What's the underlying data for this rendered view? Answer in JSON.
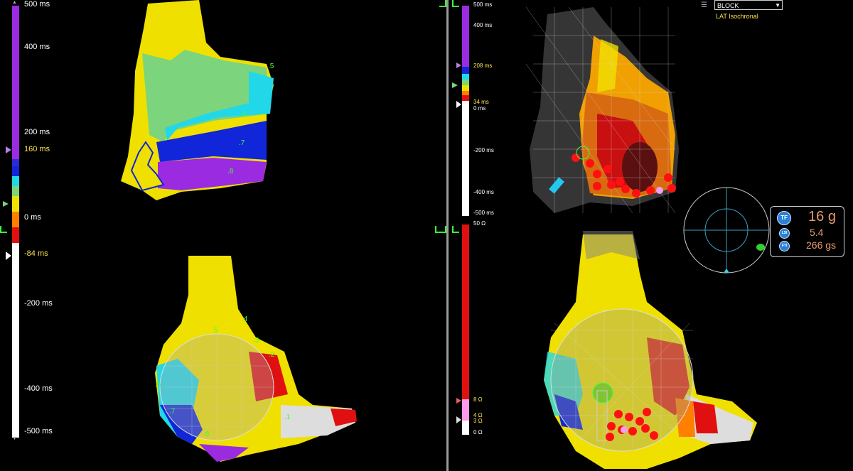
{
  "lat_scale": {
    "max": "500 ms",
    "t400": "400 ms",
    "t200": "200 ms",
    "upper_marker": "160 ms",
    "zero": "0 ms",
    "lower_marker": "-84 ms",
    "n200": "-200 ms",
    "n400": "-400 ms",
    "min": "-500 ms"
  },
  "right_lat_scale": {
    "max": "500 ms",
    "t400": "400 ms",
    "upper_marker": "208 ms",
    "lower_marker": "34 ms",
    "zero": "0 ms",
    "n200": "-200 ms",
    "n400": "-400 ms",
    "min": "-500 ms"
  },
  "impedance_scale": {
    "max": "50 Ω",
    "marker": "8 Ω",
    "low1": "4 Ω",
    "low2": "3 Ω",
    "min": "0 Ω"
  },
  "map_mode": {
    "selected": "BLOCK",
    "map_type": "LAT Isochronal"
  },
  "contact_force": {
    "tf_icon": "TF",
    "tf_value": "16",
    "tf_unit": "g",
    "lsi_icon": "LSI",
    "lsi_value": "5.4",
    "fti_icon": "FTI",
    "fti_value": "266 gs"
  },
  "top_left_points": [
    ".5",
    ".6",
    ".7",
    ".8"
  ],
  "bottom_left_points": [
    ".4",
    ".5",
    ".3",
    ".2",
    ".6",
    ".7",
    ".8",
    ".1"
  ],
  "colors": {
    "purple": "#9b2be0",
    "blue": "#1026d8",
    "cyan": "#22d8e8",
    "light_green": "#7cd47c",
    "yellow": "#f0e000",
    "orange": "#ff8000",
    "red": "#e01010"
  }
}
